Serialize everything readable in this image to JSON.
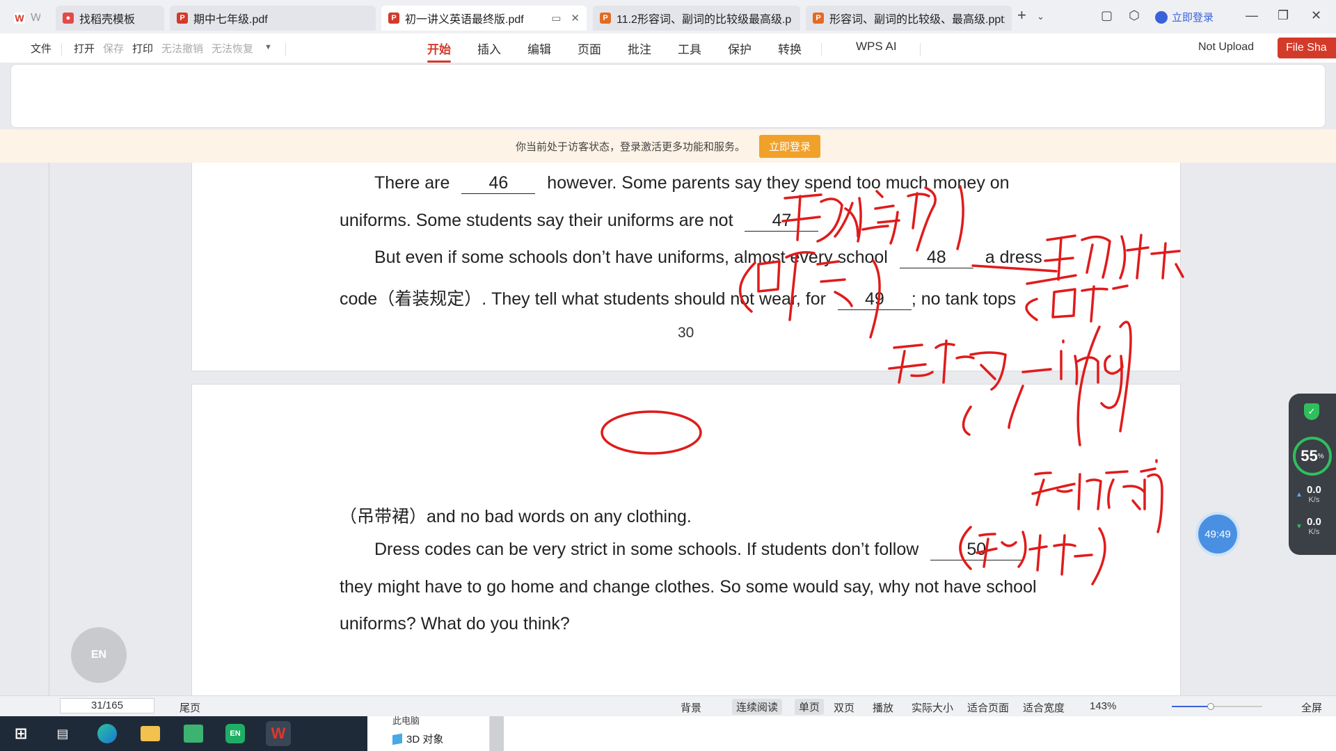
{
  "tabs": [
    {
      "label": "W",
      "color": "#d43a2a",
      "icon": "wps-logo-icon"
    },
    {
      "label": "找稻壳模板",
      "color": "#e24a4a",
      "icon": "docer-icon"
    },
    {
      "label": "期中七年级.pdf",
      "color": "#d43a2a",
      "icon": "pdf-icon"
    },
    {
      "label": "初一讲义英语最终版.pdf",
      "color": "#d43a2a",
      "icon": "pdf-icon",
      "active": true
    },
    {
      "label": "11.2形容词、副词的比较级最高级.p",
      "color": "#e36b23",
      "icon": "pptx-icon"
    },
    {
      "label": "形容词、副词的比较级、最高级.pptx",
      "color": "#e36b23",
      "icon": "pptx-icon"
    }
  ],
  "top_right": {
    "login": "立即登录"
  },
  "menu": {
    "file": "文件",
    "open": "打开",
    "save": "保存",
    "print": "打印",
    "undo": "无法撤销",
    "redo": "无法恢复"
  },
  "ribbon_tabs": [
    "开始",
    "插入",
    "编辑",
    "页面",
    "批注",
    "工具",
    "保护",
    "转换"
  ],
  "wps_ai": "WPS AI",
  "not_upload": "Not Upload",
  "file_share": "File Sha",
  "banner": {
    "text": "你当前处于访客状态，登录激活更多功能和服务。",
    "button": "立即登录"
  },
  "page1": {
    "line1_a": "There are",
    "blank46": "46",
    "line1_b": "however. Some parents say they spend too much money on",
    "line2_a": "uniforms. Some students say their uniforms are not",
    "blank47": "47",
    "line3_a": "But even if some schools don’t have uniforms, almost every school",
    "blank48": "48",
    "line3_b": "a dress",
    "line4_a": "code（着装规定）. They tell what students should not wear, for",
    "blank49": "49",
    "line4_b": "; no tank tops",
    "page_number": "30"
  },
  "page2": {
    "line1": "（吊带裙）and no bad words on any clothing.",
    "line2_a": "Dress codes can be very strict in some schools. If students don’t follow",
    "blank50": "50",
    "line3": "they might have to go home and change clothes. So some would say, why not have school",
    "line4": "uniforms? What do you think?"
  },
  "widgets": {
    "en_ball": "EN",
    "timer": "49:49",
    "perf_percent": "55",
    "perf_unit": "%",
    "upload": "0.0",
    "download": "0.0",
    "speed_unit": "K/s"
  },
  "status": {
    "page": "31/165",
    "last_page": "尾页",
    "background": "背景",
    "continuous": "连续阅读",
    "single": "单页",
    "double": "双页",
    "play": "播放",
    "actual_size": "实际大小",
    "fit_page": "适合页面",
    "fit_width": "适合宽度",
    "zoom": "143%",
    "zoom_fraction": 0.43,
    "fullscreen": "全屏"
  },
  "taskbar": {
    "explorer_row1": "此电脑",
    "explorer_row2": "3D 对象"
  },
  "ink_color": "#e01b1b"
}
